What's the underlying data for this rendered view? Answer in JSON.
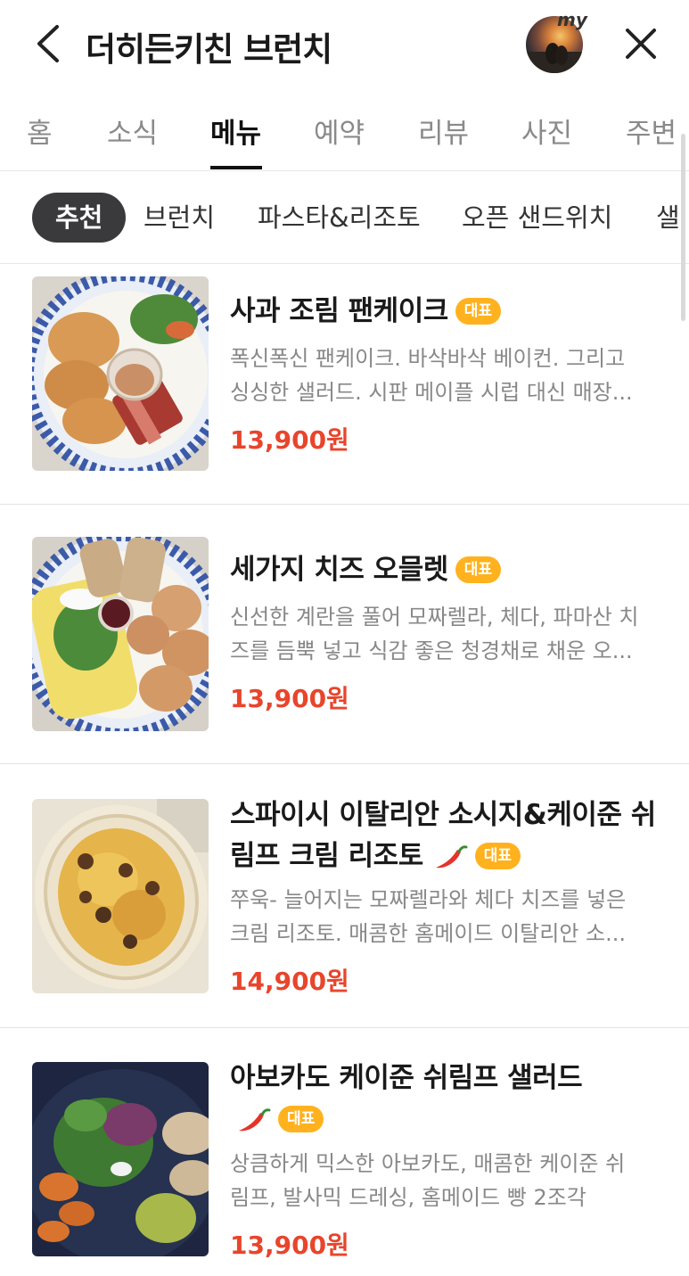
{
  "header": {
    "title": "더히든키친 브런치",
    "my_badge": "my"
  },
  "tabs": [
    "홈",
    "소식",
    "메뉴",
    "예약",
    "리뷰",
    "사진",
    "주변"
  ],
  "active_tab": "메뉴",
  "chips": [
    "추천",
    "브런치",
    "파스타&리조토",
    "오픈 샌드위치",
    "샐"
  ],
  "active_chip": "추천",
  "menu": [
    {
      "name": "사과 조림 팬케이크",
      "spicy": false,
      "badge": "대표",
      "desc_line1": "폭신폭신 팬케이크. 바삭바삭 베이컨. 그리고",
      "desc_line2": "싱싱한 샐러드. 시판 메이플 시럽 대신 매장...",
      "price": "13,900원"
    },
    {
      "name": "세가지 치즈 오믈렛",
      "spicy": false,
      "badge": "대표",
      "desc_line1": "신선한 계란을 풀어 모짜렐라, 체다, 파마산 치",
      "desc_line2": "즈를 듬뿍 넣고 식감 좋은 청경채로 채운 오...",
      "price": "13,900원"
    },
    {
      "name_line1": "스파이시 이탈리안 소시지&케이준 쉬",
      "name_line2": "림프 크림 리조토",
      "spicy": true,
      "badge": "대표",
      "desc_line1": "쭈욱- 늘어지는 모짜렐라와 체다 치즈를 넣은",
      "desc_line2": "크림 리조토. 매콤한 홈메이드 이탈리안 소...",
      "price": "14,900원"
    },
    {
      "name": "아보카도 케이준 쉬림프 샐러드",
      "spicy": true,
      "badge": "대표",
      "desc_line1": "상큼하게 믹스한 아보카도, 매콤한 케이준 쉬",
      "desc_line2": "림프, 발사믹 드레싱, 홈메이드 빵 2조각",
      "price": "13,900원"
    }
  ],
  "colors": {
    "price": "#e8452c",
    "badge": "#ffb21e",
    "active_chip_bg": "#3a3a3c"
  }
}
